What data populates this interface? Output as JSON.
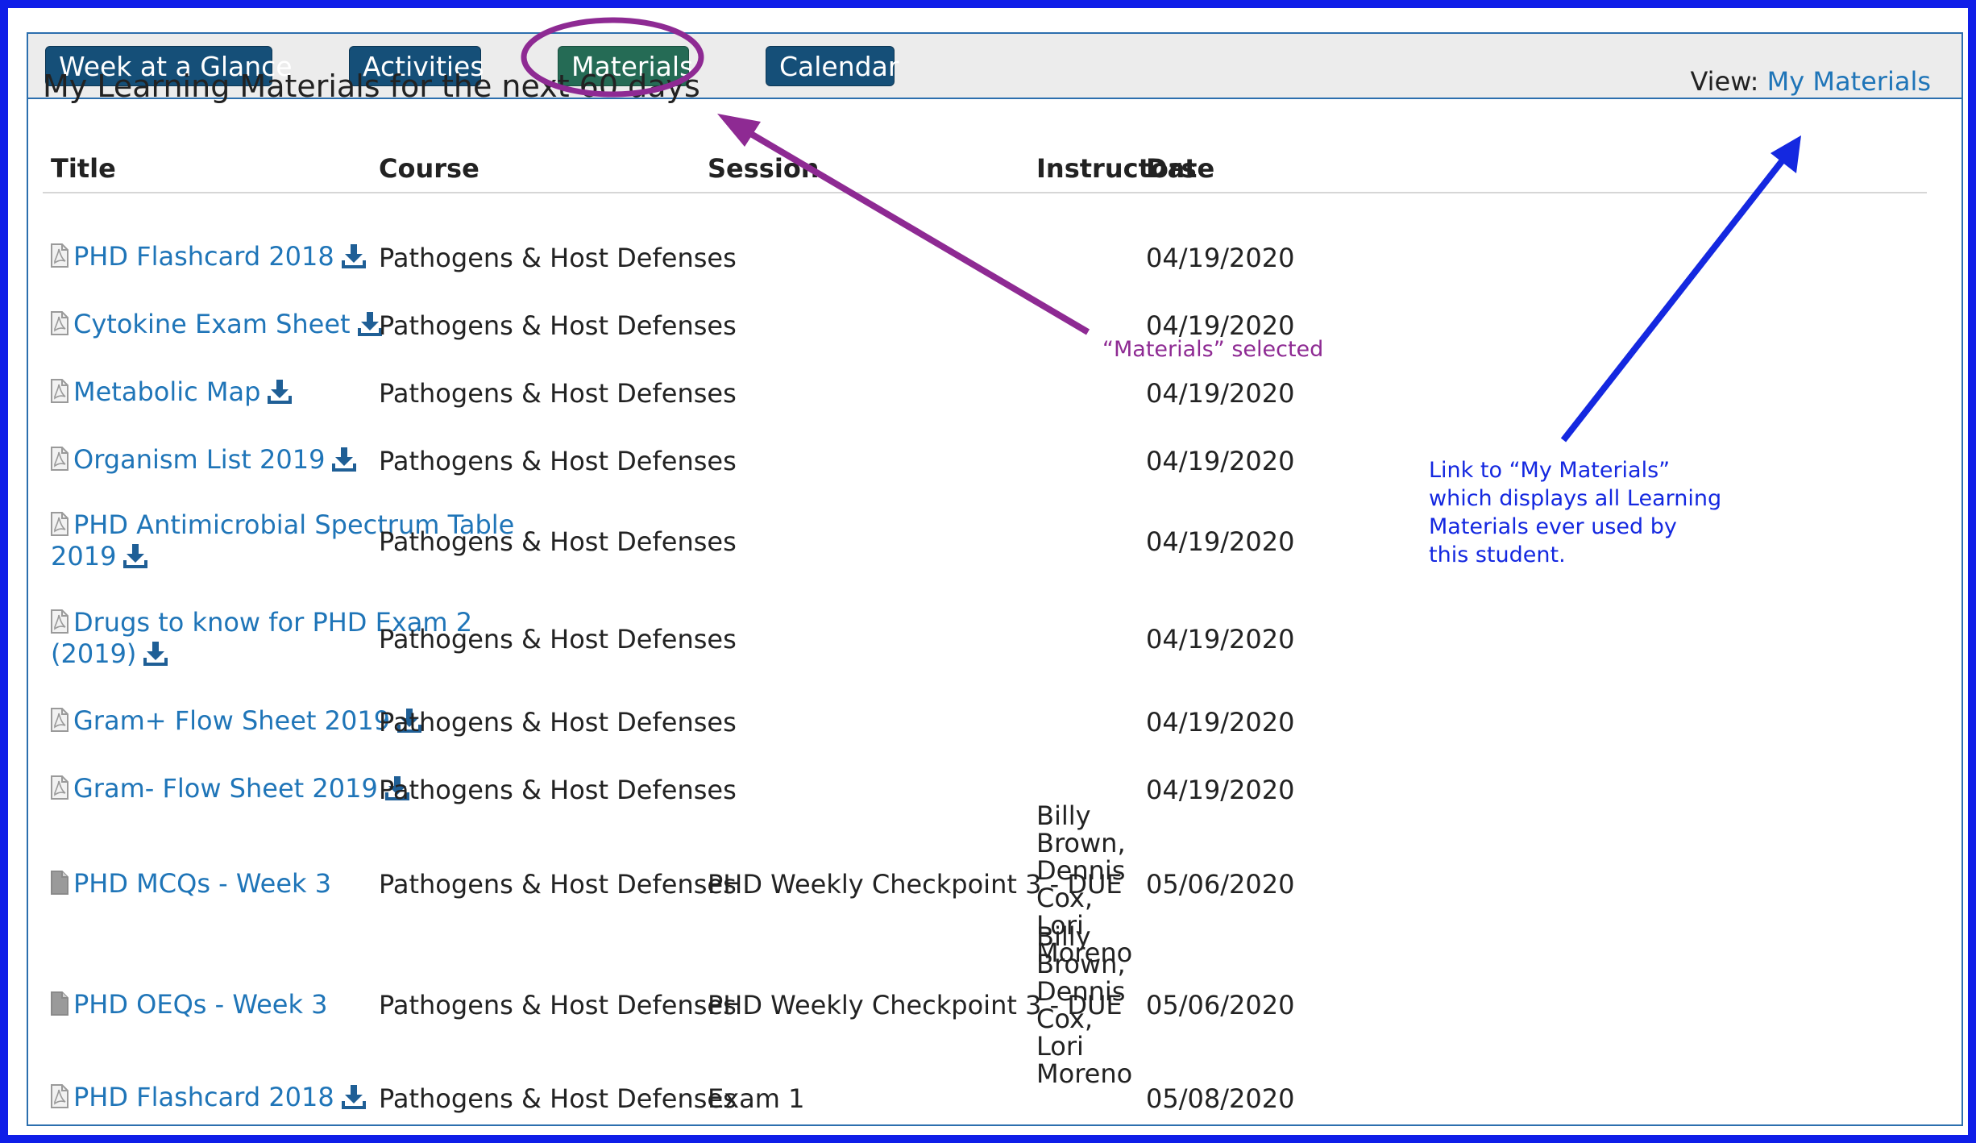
{
  "tabs": [
    {
      "label": "Week at a Glance",
      "active": false
    },
    {
      "label": "Activities",
      "active": false
    },
    {
      "label": "Materials",
      "active": true
    },
    {
      "label": "Calendar",
      "active": false
    }
  ],
  "page_title": "My Learning Materials for the next 60 days",
  "view": {
    "label": "View:",
    "link": "My Materials"
  },
  "columns": [
    "Title",
    "Course",
    "Session",
    "Instructors",
    "Date"
  ],
  "rows": [
    {
      "title": "PHD Flashcard 2018",
      "file": "pdf",
      "download": true,
      "course": "Pathogens & Host Defenses",
      "session": "",
      "instructors": [],
      "date": "04/19/2020"
    },
    {
      "title": "Cytokine Exam Sheet",
      "file": "pdf",
      "download": true,
      "course": "Pathogens & Host Defenses",
      "session": "",
      "instructors": [],
      "date": "04/19/2020"
    },
    {
      "title": "Metabolic Map",
      "file": "pdf",
      "download": true,
      "course": "Pathogens & Host Defenses",
      "session": "",
      "instructors": [],
      "date": "04/19/2020"
    },
    {
      "title": "Organism List 2019",
      "file": "pdf",
      "download": true,
      "course": "Pathogens & Host Defenses",
      "session": "",
      "instructors": [],
      "date": "04/19/2020"
    },
    {
      "title": "PHD Antimicrobial Spectrum Table 2019",
      "file": "pdf",
      "download": true,
      "course": "Pathogens & Host Defenses",
      "session": "",
      "instructors": [],
      "date": "04/19/2020"
    },
    {
      "title": "Drugs to know for PHD Exam 2 (2019)",
      "file": "pdf",
      "download": true,
      "course": "Pathogens & Host Defenses",
      "session": "",
      "instructors": [],
      "date": "04/19/2020"
    },
    {
      "title": "Gram+ Flow Sheet 2019",
      "file": "pdf",
      "download": true,
      "course": "Pathogens & Host Defenses",
      "session": "",
      "instructors": [],
      "date": "04/19/2020"
    },
    {
      "title": "Gram- Flow Sheet 2019",
      "file": "pdf",
      "download": true,
      "course": "Pathogens & Host Defenses",
      "session": "",
      "instructors": [],
      "date": "04/19/2020"
    },
    {
      "title": "PHD MCQs - Week 3",
      "file": "doc",
      "download": false,
      "course": "Pathogens & Host Defenses",
      "session": "PHD Weekly Checkpoint 3 - DUE",
      "instructors": [
        "Billy Brown,",
        "Dennis Cox,",
        "Lori Moreno"
      ],
      "date": "05/06/2020"
    },
    {
      "title": "PHD OEQs - Week 3",
      "file": "doc",
      "download": false,
      "course": "Pathogens & Host Defenses",
      "session": "PHD Weekly Checkpoint 3 - DUE",
      "instructors": [
        "Billy Brown,",
        "Dennis Cox,",
        "Lori Moreno"
      ],
      "date": "05/06/2020"
    },
    {
      "title": "PHD Flashcard 2018",
      "file": "pdf",
      "download": true,
      "course": "Pathogens & Host Defenses",
      "session": "Exam 1",
      "instructors": [],
      "date": "05/08/2020"
    }
  ],
  "annotations": {
    "materials_selected": "“Materials” selected",
    "my_materials": [
      "Link to “My Materials”",
      "which displays all Learning",
      "Materials ever used by",
      "this student."
    ]
  },
  "colors": {
    "frame": "#0f1ee8",
    "tab_bg": "#154f78",
    "tab_active_bg": "#256b55",
    "link": "#1f75b8",
    "annotation_purple": "#8e2a93",
    "annotation_blue": "#1428e0"
  },
  "icons": {
    "file": "pdf-file-icon",
    "doc": "document-icon",
    "download": "download-icon"
  }
}
